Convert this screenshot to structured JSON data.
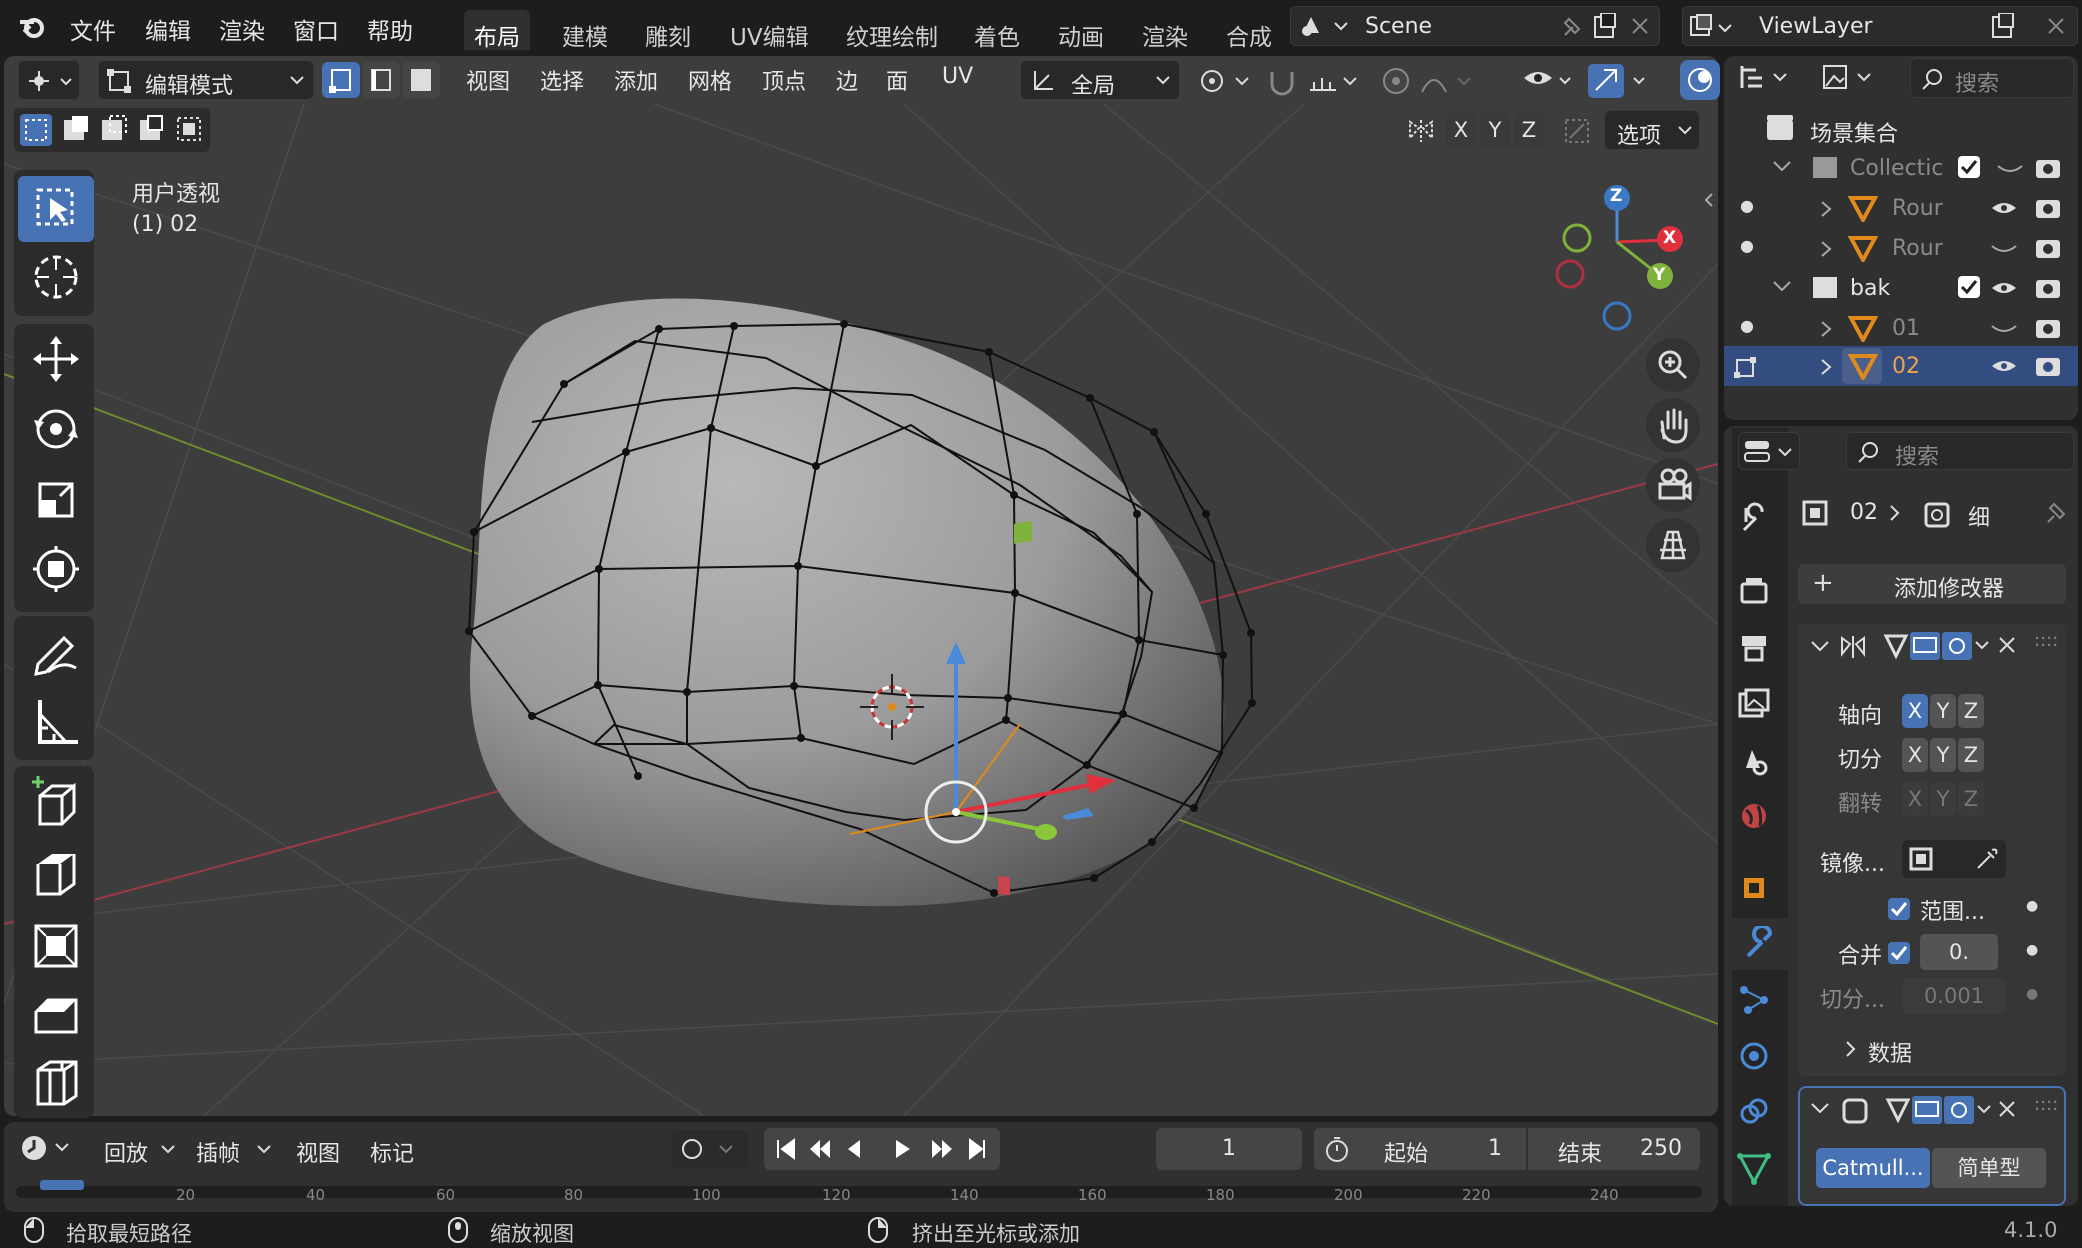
{
  "menu": [
    "文件",
    "编辑",
    "渲染",
    "窗口",
    "帮助"
  ],
  "workspaces": [
    "布局",
    "建模",
    "雕刻",
    "UV编辑",
    "纹理绘制",
    "着色",
    "动画",
    "渲染",
    "合成"
  ],
  "active_workspace": "布局",
  "scene_name": "Scene",
  "view_layer": "ViewLayer",
  "header": {
    "mode": "编辑模式",
    "menus": [
      "视图",
      "选择",
      "添加",
      "网格",
      "顶点",
      "边",
      "面",
      "UV"
    ],
    "transform_orientation": "全局",
    "mirror_axes": [
      "X",
      "Y",
      "Z"
    ],
    "options_label": "选项"
  },
  "viewport": {
    "view_name": "用户透视",
    "object_info": "(1) 02",
    "gizmo_axes": [
      "Z",
      "X",
      "Y"
    ]
  },
  "outliner": {
    "search_placeholder": "搜索",
    "root": "场景集合",
    "rows": [
      {
        "label": "Collectic",
        "type": "collection",
        "dim": true
      },
      {
        "label": "Rour",
        "type": "mesh",
        "dim": true
      },
      {
        "label": "Rour",
        "type": "mesh",
        "dim": true
      },
      {
        "label": "bak",
        "type": "collection",
        "dim": false
      },
      {
        "label": "01",
        "type": "mesh",
        "dim": true
      },
      {
        "label": "02",
        "type": "mesh",
        "dim": false,
        "selected": true
      }
    ]
  },
  "properties": {
    "search_placeholder": "搜索",
    "breadcrumb_object": "02",
    "breadcrumb_modifier": "细",
    "add_modifier": "添加修改器",
    "mirror": {
      "axis_label": "轴向",
      "bisect_label": "切分",
      "flip_label": "翻转",
      "mirror_object_label": "镜像...",
      "clipping_label": "范围...",
      "merge_label": "合并",
      "merge_value": "0.",
      "bisect_distance_label": "切分...",
      "bisect_distance_value": "0.001",
      "data_label": "数据"
    },
    "subsurf": {
      "catmull": "Catmull...",
      "simple": "简单型"
    }
  },
  "timeline": {
    "playback": "回放",
    "keying": "插帧",
    "view": "视图",
    "marker": "标记",
    "current_frame": "1",
    "start_label": "起始",
    "start_value": "1",
    "end_label": "结束",
    "end_value": "250",
    "ruler": [
      "20",
      "40",
      "60",
      "80",
      "100",
      "120",
      "140",
      "160",
      "180",
      "200",
      "220",
      "240"
    ]
  },
  "statusbar": {
    "hint1": "拾取最短路径",
    "hint2": "缩放视图",
    "hint3": "挤出至光标或添加",
    "version": "4.1.0"
  }
}
